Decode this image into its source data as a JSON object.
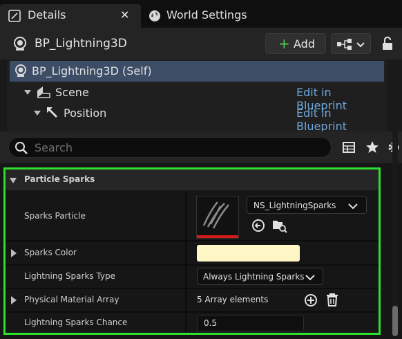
{
  "tabs": [
    {
      "label": "Details",
      "active": true
    },
    {
      "label": "World Settings",
      "active": false
    }
  ],
  "header": {
    "actor_name": "BP_Lightning3D",
    "add_label": "Add"
  },
  "tree": {
    "items": [
      {
        "label": "BP_Lightning3D (Self)",
        "edit": ""
      },
      {
        "label": "Scene",
        "edit": "Edit in Blueprint"
      },
      {
        "label": "Position",
        "edit": "Edit in Blueprint"
      }
    ]
  },
  "search": {
    "placeholder": "Search"
  },
  "details": {
    "category": "Particle Sparks",
    "properties": [
      {
        "label": "Sparks Particle",
        "value": "NS_LightningSparks"
      },
      {
        "label": "Sparks Color",
        "value": ""
      },
      {
        "label": "Lightning Sparks Type",
        "value": "Always Lightning Sparks"
      },
      {
        "label": "Physical Material Array",
        "value": "5 Array elements"
      },
      {
        "label": "Lightning Sparks Chance",
        "value": "0.5"
      }
    ]
  },
  "colors": {
    "accent_green": "#2ee02e",
    "sparks_color": "#fff8c6",
    "selection": "#3d4d66",
    "link": "#6fa8dc"
  }
}
